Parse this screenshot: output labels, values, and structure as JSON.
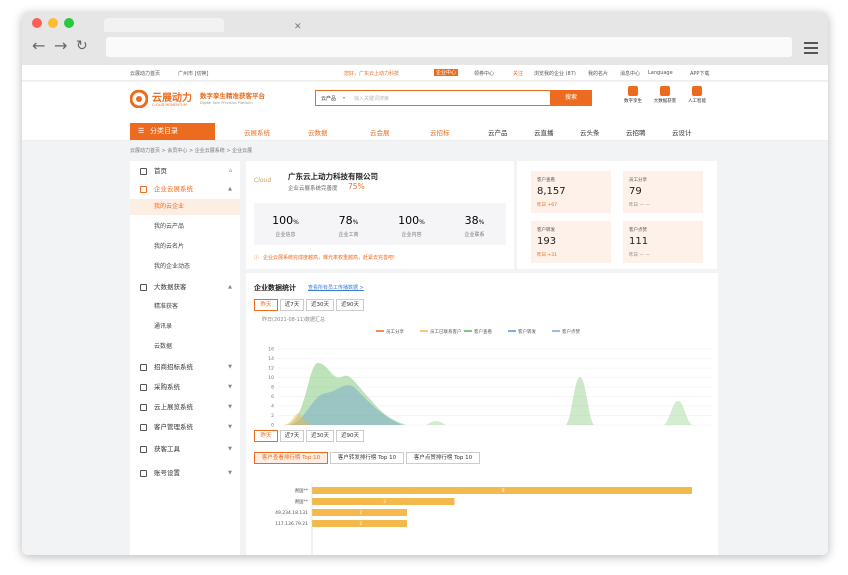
{
  "topbar": {
    "home": "云展动力首页",
    "location": "广州市 [切换]",
    "greeting": "您好，广东云上动力科技",
    "cloud_center": "企业中心",
    "receive": "领券中心",
    "bell": "关注",
    "collect": "浏览我的企业 (87)",
    "mycard": "我的名片",
    "message": "消息中心",
    "language": "Language",
    "app": "APP下载"
  },
  "header": {
    "brand": "云展动力",
    "brand_en": "CLOUD MOMENTUM",
    "slogan": "数字孪生精准获客平台",
    "slogan2": "Digital Twin Precision Platform",
    "search_category": "云产品",
    "search_placeholder": "输入关键词搜索",
    "search_button": "搜索",
    "right_icons": [
      {
        "label": "数字孪生"
      },
      {
        "label": "大数据获客"
      },
      {
        "label": "人工智能"
      }
    ]
  },
  "nav": {
    "category": "分类目录",
    "items": [
      {
        "label": "云展系统"
      },
      {
        "label": "云数据"
      },
      {
        "label": "云会展"
      },
      {
        "label": "云招标"
      },
      {
        "label": "云产品"
      },
      {
        "label": "云直播"
      },
      {
        "label": "云头条"
      },
      {
        "label": "云招聘"
      },
      {
        "label": "云设计"
      }
    ]
  },
  "breadcrumb": "云展动力首页  >  会员中心  >  企业云展系统  >  企业云展",
  "sidebar": {
    "items": [
      {
        "label": "首页"
      },
      {
        "label": "企业云展系统"
      },
      {
        "label": "我的云企业"
      },
      {
        "label": "我的云产品"
      },
      {
        "label": "我的云名片"
      },
      {
        "label": "我的企业动态"
      },
      {
        "label": "大数据获客"
      },
      {
        "label": "精准获客"
      },
      {
        "label": "通讯录"
      },
      {
        "label": "云数据"
      },
      {
        "label": "招商招标系统"
      },
      {
        "label": "采购系统"
      },
      {
        "label": "云上展览系统"
      },
      {
        "label": "客户管理系统"
      },
      {
        "label": "获客工具"
      },
      {
        "label": "账号设置"
      }
    ]
  },
  "company": {
    "name": "广东云上动力科技有限公司",
    "completeness_label": "企业云展系统完善度",
    "completeness_value": "75%",
    "logo_text": "Cloud",
    "metrics": [
      {
        "value": "100",
        "unit": "%",
        "label": "企业信息"
      },
      {
        "value": "78",
        "unit": "%",
        "label": "企业工商"
      },
      {
        "value": "100",
        "unit": "%",
        "label": "企业内容"
      },
      {
        "value": "38",
        "unit": "%",
        "label": "企业联系"
      }
    ],
    "notice": "企业云展系统完成度越高，曝光率权重越高，赶紧去完善吧!"
  },
  "stats": [
    {
      "label": "客户查看",
      "value": "8,157",
      "delta": "昨日 +67"
    },
    {
      "label": "员工分享",
      "value": "79",
      "delta": "昨日 — —"
    },
    {
      "label": "客户转发",
      "value": "193",
      "delta": "昨日 +31"
    },
    {
      "label": "客户点赞",
      "value": "111",
      "delta": "昨日 — —"
    }
  ],
  "analytics": {
    "title": "企业数据统计",
    "link": "查看所有员工传播数据 >",
    "tabs": [
      "昨天",
      "近7天",
      "近30天",
      "近90天"
    ],
    "date_note": "昨日(2021-08-11)数据汇总",
    "tabs2": [
      "昨天",
      "近7天",
      "近30天",
      "近90天"
    ],
    "rank_tabs": [
      "客户查看排行榜 Top 10",
      "客户转发排行榜 Top 10",
      "客户点赞排行榜 Top 10"
    ]
  },
  "chart_data": [
    {
      "type": "area",
      "series": [
        {
          "name": "员工分享"
        },
        {
          "name": "员工已联系客户"
        },
        {
          "name": "客户查看"
        },
        {
          "name": "客户转发"
        },
        {
          "name": "客户点赞"
        }
      ],
      "yticks": [
        0,
        2,
        4,
        6,
        8,
        10,
        12,
        14,
        16
      ],
      "ylim": [
        0,
        16
      ]
    },
    {
      "type": "bar",
      "orientation": "horizontal",
      "categories": [
        "谢国**",
        "谢国**",
        "49.234.18.131",
        "117.136.79.21"
      ],
      "values": [
        8,
        3,
        2,
        2
      ],
      "color": "#f3b94c"
    }
  ]
}
